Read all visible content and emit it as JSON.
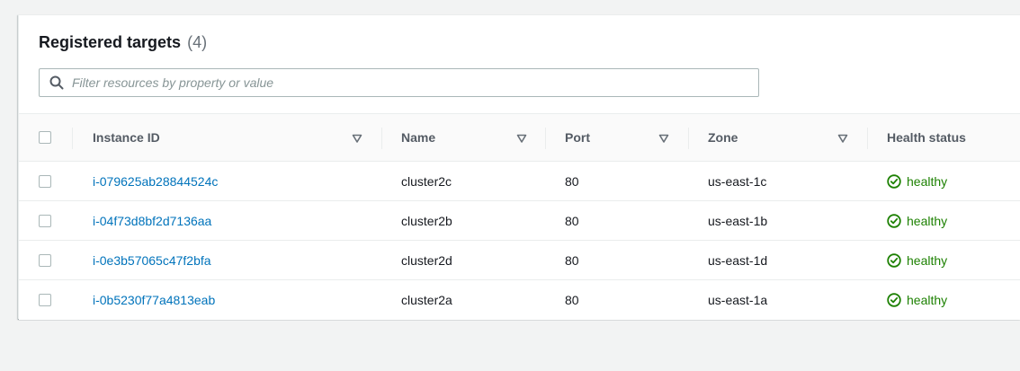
{
  "panel": {
    "title": "Registered targets",
    "count": "(4)"
  },
  "filter": {
    "value": "",
    "placeholder": "Filter resources by property or value"
  },
  "table": {
    "columns": {
      "instance_id": "Instance ID",
      "name": "Name",
      "port": "Port",
      "zone": "Zone",
      "health": "Health status"
    },
    "rows": [
      {
        "instance_id": "i-079625ab28844524c",
        "name": "cluster2c",
        "port": "80",
        "zone": "us-east-1c",
        "health": "healthy"
      },
      {
        "instance_id": "i-04f73d8bf2d7136aa",
        "name": "cluster2b",
        "port": "80",
        "zone": "us-east-1b",
        "health": "healthy"
      },
      {
        "instance_id": "i-0e3b57065c47f2bfa",
        "name": "cluster2d",
        "port": "80",
        "zone": "us-east-1d",
        "health": "healthy"
      },
      {
        "instance_id": "i-0b5230f77a4813eab",
        "name": "cluster2a",
        "port": "80",
        "zone": "us-east-1a",
        "health": "healthy"
      }
    ]
  },
  "icons": {
    "search": "search-icon",
    "sort": "caret-down-icon",
    "status": "check-circle-icon"
  },
  "colors": {
    "link": "#0073bb",
    "healthy": "#1d8102",
    "header_text": "#545b64",
    "border": "#eaeded"
  }
}
